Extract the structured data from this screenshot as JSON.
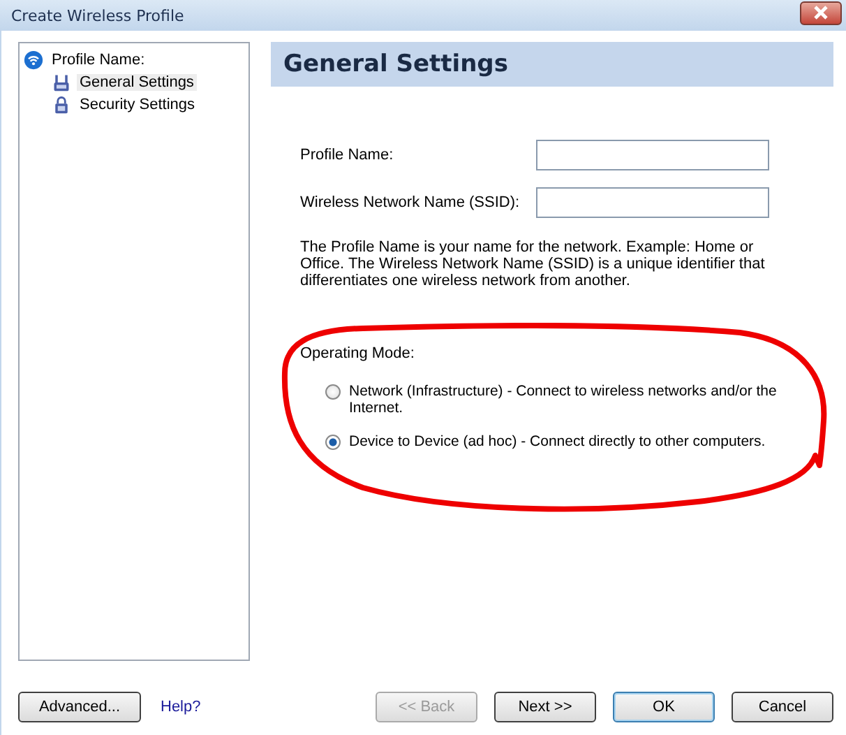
{
  "window": {
    "title": "Create Wireless Profile"
  },
  "tree": {
    "label": "Profile Name:",
    "children": [
      {
        "label": "General Settings",
        "kind": "antenna",
        "selected": true
      },
      {
        "label": "Security Settings",
        "kind": "lock",
        "selected": false
      }
    ]
  },
  "header": {
    "title": "General Settings"
  },
  "fields": [
    {
      "label": "Profile Name:"
    },
    {
      "label": "Wireless Network Name (SSID):"
    }
  ],
  "description": "The Profile Name is your name for the network. Example: Home or Office. The Wireless Network Name (SSID) is a unique identifier that differentiates one wireless network from another.",
  "operating_mode": {
    "label": "Operating Mode:",
    "options": [
      {
        "label": "Network (Infrastructure) - Connect to wireless networks and/or the Internet.",
        "selected": false
      },
      {
        "label": "Device to Device (ad hoc) - Connect directly to other computers.",
        "selected": true
      }
    ]
  },
  "annotation": {
    "kind": "loop"
  },
  "buttons_left": [
    {
      "label": "Advanced...",
      "kind": "button",
      "disabled": false
    },
    {
      "label": "Help?",
      "kind": "link",
      "disabled": false
    }
  ],
  "buttons_right": [
    {
      "label": "<< Back",
      "disabled": true,
      "default": false
    },
    {
      "label": "Next >>",
      "disabled": false,
      "default": false
    },
    {
      "label": "OK",
      "disabled": false,
      "default": true
    },
    {
      "label": "Cancel",
      "disabled": false,
      "default": false
    }
  ]
}
